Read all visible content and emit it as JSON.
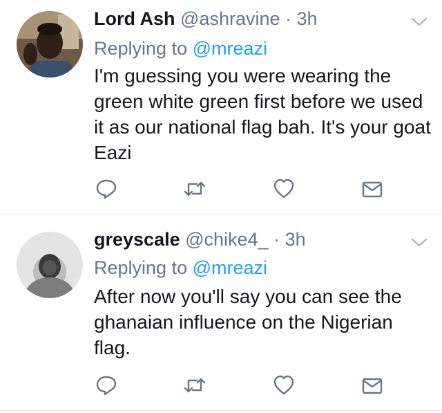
{
  "tweets": [
    {
      "display_name": "Lord Ash",
      "handle": "@ashravine",
      "separator": "·",
      "time": "3h",
      "replying_prefix": "Replying to",
      "replying_to": "@mreazi",
      "text": "I'm guessing you were wearing the green white green first before we used it as our national flag bah. It's your goat Eazi",
      "icons": [
        "reply-icon",
        "retweet-icon",
        "like-icon",
        "direct-message-icon",
        "chevron-down-icon"
      ]
    },
    {
      "display_name": "greyscale",
      "handle": "@chike4_",
      "separator": "·",
      "time": "3h",
      "replying_prefix": "Replying to",
      "replying_to": "@mreazi",
      "text": "After now you'll say you can see the ghanaian influence on the Nigerian flag.",
      "icons": [
        "reply-icon",
        "retweet-icon",
        "like-icon",
        "direct-message-icon",
        "chevron-down-icon"
      ]
    }
  ],
  "colors": {
    "link": "#1da1f2",
    "muted": "#657786",
    "text": "#14171a",
    "divider": "#e1e8ed"
  }
}
